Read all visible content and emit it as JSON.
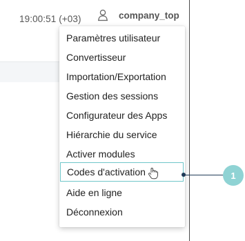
{
  "header": {
    "time": "19:00:51 (+03)",
    "username": "company_top",
    "user_icon": "user-icon"
  },
  "menu": {
    "items": [
      {
        "label": "Paramètres utilisateur"
      },
      {
        "label": "Convertisseur"
      },
      {
        "label": "Importation/Exportation"
      },
      {
        "label": "Gestion des sessions"
      },
      {
        "label": "Configurateur des Apps"
      },
      {
        "label": "Hiérarchie du service"
      },
      {
        "label": "Activer modules"
      },
      {
        "label": "Codes d'activation",
        "state": "hover",
        "cursor_icon": "hand-pointer-icon"
      },
      {
        "label": "Aide en ligne"
      },
      {
        "label": "Déconnexion"
      }
    ]
  },
  "callout": {
    "number": "1"
  },
  "colors": {
    "hover_border": "#6fc6c9",
    "callout_fill": "#8fd3d4",
    "callout_line": "#1f3a57",
    "text": "#222222"
  }
}
